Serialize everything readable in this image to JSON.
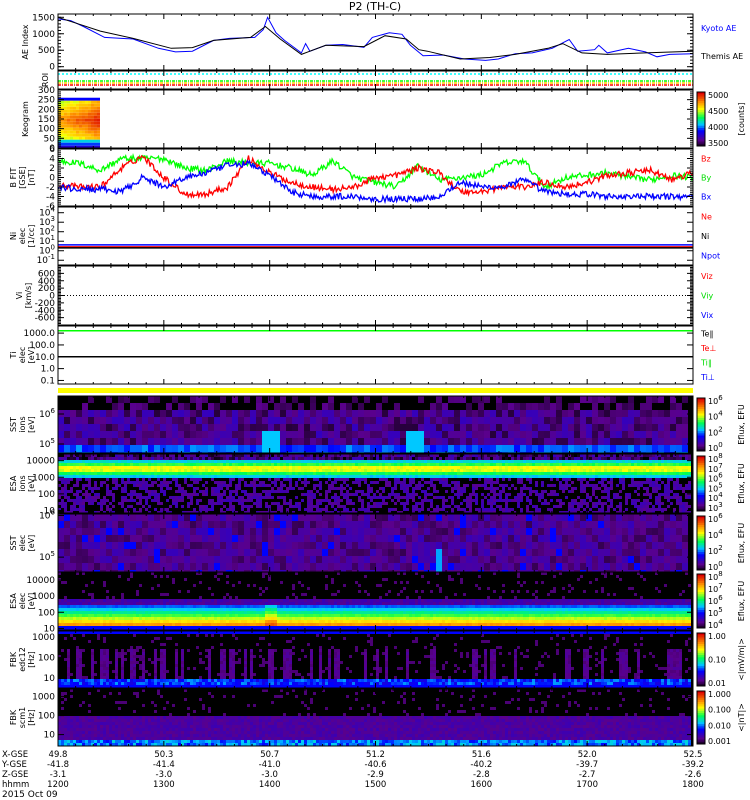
{
  "title": "P2 (TH-C)",
  "date": "2015 Oct 09",
  "ephemeris": {
    "rows": [
      {
        "label": "X-GSE",
        "values": [
          "49.8",
          "50.3",
          "50.7",
          "51.2",
          "51.6",
          "52.0",
          "52.5"
        ]
      },
      {
        "label": "Y-GSE",
        "values": [
          "-41.8",
          "-41.4",
          "-41.0",
          "-40.6",
          "-40.2",
          "-39.7",
          "-39.2"
        ]
      },
      {
        "label": "Z-GSE",
        "values": [
          "-3.1",
          "-3.0",
          "-3.0",
          "-2.9",
          "-2.8",
          "-2.7",
          "-2.6"
        ]
      },
      {
        "label": "hhmm",
        "values": [
          "1200",
          "1300",
          "1400",
          "1500",
          "1600",
          "1700",
          "1800"
        ]
      }
    ]
  },
  "chart_data": [
    {
      "id": "ae",
      "type": "line",
      "ylabel": [
        "AE Index"
      ],
      "ylim": [
        -100,
        1600
      ],
      "log": false,
      "yticks": [
        {
          "v": 1500,
          "l": "1500"
        },
        {
          "v": 1000,
          "l": "1000"
        },
        {
          "v": 500,
          "l": "500"
        },
        {
          "v": 0,
          "l": "0"
        }
      ],
      "legend": [
        {
          "text": "Kyoto AE",
          "color": "#0000ff"
        },
        {
          "text": "Themis AE",
          "color": "#000000"
        }
      ],
      "series": [
        {
          "name": "Kyoto AE",
          "color": "#0000ff",
          "points": [
            [
              12.0,
              1450
            ],
            [
              12.12,
              1400
            ],
            [
              12.24,
              1220
            ],
            [
              12.44,
              890
            ],
            [
              12.71,
              840
            ],
            [
              12.95,
              560
            ],
            [
              13.11,
              450
            ],
            [
              13.27,
              470
            ],
            [
              13.47,
              800
            ],
            [
              13.62,
              860
            ],
            [
              13.86,
              890
            ],
            [
              13.94,
              1125
            ],
            [
              13.98,
              1500
            ],
            [
              14.06,
              1030
            ],
            [
              14.14,
              800
            ],
            [
              14.3,
              420
            ],
            [
              14.34,
              700
            ],
            [
              14.38,
              470
            ],
            [
              14.53,
              650
            ],
            [
              14.69,
              675
            ],
            [
              14.89,
              590
            ],
            [
              14.97,
              890
            ],
            [
              15.13,
              1030
            ],
            [
              15.25,
              985
            ],
            [
              15.33,
              650
            ],
            [
              15.45,
              330
            ],
            [
              15.64,
              356
            ],
            [
              15.84,
              235
            ],
            [
              16.04,
              190
            ],
            [
              16.16,
              235
            ],
            [
              16.32,
              395
            ],
            [
              16.48,
              420
            ],
            [
              16.67,
              560
            ],
            [
              16.83,
              825
            ],
            [
              16.91,
              470
            ],
            [
              17.07,
              515
            ],
            [
              17.11,
              650
            ],
            [
              17.19,
              420
            ],
            [
              17.39,
              560
            ],
            [
              17.55,
              450
            ],
            [
              17.66,
              300
            ],
            [
              17.78,
              375
            ],
            [
              18.0,
              395
            ]
          ]
        },
        {
          "name": "Themis AE",
          "color": "#000000",
          "points": [
            [
              12.0,
              1500
            ],
            [
              12.2,
              1290
            ],
            [
              12.4,
              1080
            ],
            [
              12.71,
              860
            ],
            [
              13.07,
              560
            ],
            [
              13.27,
              580
            ],
            [
              13.47,
              800
            ],
            [
              13.82,
              890
            ],
            [
              13.96,
              1220
            ],
            [
              14.1,
              840
            ],
            [
              14.3,
              375
            ],
            [
              14.38,
              470
            ],
            [
              14.53,
              650
            ],
            [
              14.89,
              610
            ],
            [
              15.09,
              940
            ],
            [
              15.29,
              840
            ],
            [
              15.41,
              515
            ],
            [
              15.49,
              470
            ],
            [
              15.8,
              235
            ],
            [
              16.08,
              280
            ],
            [
              16.32,
              375
            ],
            [
              16.63,
              560
            ],
            [
              16.77,
              700
            ],
            [
              16.95,
              420
            ],
            [
              17.19,
              375
            ],
            [
              17.55,
              420
            ],
            [
              18.0,
              470
            ]
          ]
        }
      ]
    },
    {
      "id": "roi",
      "type": "line",
      "ylabel": [
        "ROI"
      ],
      "yticks": [],
      "legend": [],
      "series": [
        {
          "color": "#00ffff"
        },
        {
          "color": "#00ff00"
        },
        {
          "color": "#ffcc00"
        },
        {
          "color": "#ff0000"
        }
      ]
    },
    {
      "id": "keo",
      "type": "heatmap",
      "ylabel": [
        "Keogram"
      ],
      "ylim": [
        0,
        300
      ],
      "log": false,
      "yticks": [
        {
          "v": 300,
          "l": "300"
        },
        {
          "v": 250,
          "l": "250"
        },
        {
          "v": 200,
          "l": "200"
        },
        {
          "v": 150,
          "l": "150"
        },
        {
          "v": 100,
          "l": "100"
        },
        {
          "v": 50,
          "l": "50"
        },
        {
          "v": 0,
          "l": "0"
        }
      ],
      "coverage": {
        "t_start": 12.0,
        "t_end": 12.4,
        "y_max": 260
      },
      "colorbar": {
        "labels": [
          "5000",
          "4500",
          "4000",
          "3500"
        ],
        "title": "[counts]"
      },
      "legend": []
    },
    {
      "id": "b",
      "type": "line",
      "ylabel": [
        "B FIT",
        "[GSE]",
        "[nT]"
      ],
      "ylim": [
        -6,
        6
      ],
      "log": false,
      "yticks": [
        {
          "v": 6,
          "l": "6"
        },
        {
          "v": 4,
          "l": "4"
        },
        {
          "v": 2,
          "l": "2"
        },
        {
          "v": 0,
          "l": "0"
        },
        {
          "v": -2,
          "l": "-2"
        },
        {
          "v": -4,
          "l": "-4"
        },
        {
          "v": -6,
          "l": "-6"
        }
      ],
      "legend": [
        {
          "text": "Bz",
          "color": "#ff0000"
        },
        {
          "text": "By",
          "color": "#00dd00"
        },
        {
          "text": "Bx",
          "color": "#0000ff"
        }
      ],
      "t0": 12.0,
      "dt": 0.2,
      "series": [
        {
          "name": "By",
          "color": "#00ff00",
          "values": [
            3.5,
            3,
            1.5,
            4,
            4,
            4,
            2,
            1.5,
            3.5,
            3,
            3,
            2,
            0.5,
            3.5,
            0,
            -1,
            -2,
            2.5,
            -0.5,
            0,
            0.5,
            3,
            3.5,
            -2,
            0,
            0.5,
            1,
            0,
            -0.5,
            0.5,
            0
          ]
        },
        {
          "name": "Bz",
          "color": "#ff0000",
          "values": [
            -1.5,
            -2,
            -2,
            2,
            4.5,
            0,
            -3.5,
            -3.5,
            -2,
            4,
            1,
            -1,
            -2,
            -2.5,
            -2,
            0,
            0.5,
            2,
            1,
            -3,
            -3,
            -2,
            -2,
            -1,
            -2,
            -1,
            0.5,
            1,
            1.5,
            -0.5,
            1
          ]
        },
        {
          "name": "Bx",
          "color": "#0000ff",
          "values": [
            -2,
            -2.5,
            -2.5,
            -3,
            0,
            -2,
            0,
            1,
            2.5,
            3,
            0.5,
            -3,
            -4,
            -4,
            -4,
            -4.5,
            -4.5,
            -4.5,
            -4,
            -1,
            -2,
            -2,
            -0.5,
            -3,
            -3.5,
            -3.5,
            -4,
            -4,
            -4,
            -4,
            -4
          ]
        }
      ]
    },
    {
      "id": "ni",
      "type": "line",
      "ylabel": [
        "Ni",
        "elec",
        "[1/cc]"
      ],
      "ylim": [
        -1.5,
        4.6
      ],
      "log": true,
      "yticks": [
        {
          "v": 4,
          "l": "10^4"
        },
        {
          "v": 3,
          "l": "10^3"
        },
        {
          "v": 2,
          "l": "10^2"
        },
        {
          "v": 1,
          "l": "10^1"
        },
        {
          "v": 0,
          "l": "10^0"
        },
        {
          "v": -1,
          "l": "10^-1"
        }
      ],
      "legend": [
        {
          "text": "Ne",
          "color": "#ff0000"
        },
        {
          "text": "Ni",
          "color": "#000000"
        },
        {
          "text": "Npot",
          "color": "#0000ff"
        }
      ],
      "series": [
        {
          "name": "Npot",
          "color": "#0000ff",
          "log_value": 0.62
        },
        {
          "name": "Ne",
          "color": "#ff0000",
          "log_value": 0.4
        },
        {
          "name": "Ni",
          "color": "#000000",
          "log_value": 0.3
        }
      ]
    },
    {
      "id": "vi",
      "type": "line",
      "ylabel": [
        "Vi",
        "[km/s]"
      ],
      "ylim": [
        -800,
        800
      ],
      "log": false,
      "yticks": [
        {
          "v": 600,
          "l": "600"
        },
        {
          "v": 400,
          "l": "400"
        },
        {
          "v": 200,
          "l": "200"
        },
        {
          "v": 0,
          "l": "0"
        },
        {
          "v": -200,
          "l": "-200"
        },
        {
          "v": -400,
          "l": "-400"
        },
        {
          "v": -600,
          "l": "-600"
        }
      ],
      "legend": [
        {
          "text": "Viz",
          "color": "#ff0000"
        },
        {
          "text": "Viy",
          "color": "#00dd00"
        },
        {
          "text": "Vix",
          "color": "#0000ff"
        }
      ],
      "series": []
    },
    {
      "id": "ti",
      "type": "line",
      "ylabel": [
        "Ti",
        "elec",
        "[eV]"
      ],
      "ylim": [
        -1.3,
        3.6
      ],
      "log": true,
      "yticks": [
        {
          "v": 3,
          "l": "1000.0"
        },
        {
          "v": 2,
          "l": "100.0"
        },
        {
          "v": 1,
          "l": "10.0"
        },
        {
          "v": 0,
          "l": "1.0"
        },
        {
          "v": -1,
          "l": "0.1"
        }
      ],
      "legend": [
        {
          "text": "Te∥",
          "color": "#000000"
        },
        {
          "text": "Te⊥",
          "color": "#ff0000"
        },
        {
          "text": "Ti∥",
          "color": "#00dd00"
        },
        {
          "text": "Ti⊥",
          "color": "#0000ff"
        }
      ],
      "series": [
        {
          "name": "Ti∥",
          "color": "#00ff00",
          "log_value": 3.2
        },
        {
          "name": "Te∥",
          "color": "#000000",
          "log_value": 1.0
        }
      ]
    },
    {
      "id": "sst1",
      "type": "heatmap",
      "ylabel": [
        "SST",
        "ions",
        "[eV]"
      ],
      "ylim": [
        4.7,
        6.6
      ],
      "log": true,
      "yticks": [
        {
          "v": 6,
          "l": "10^6"
        },
        {
          "v": 5,
          "l": "10^5"
        }
      ],
      "colorbar": {
        "labels": [
          "10^6",
          "10^4",
          "10^2",
          "10^0"
        ],
        "title": "Eflux, EFU"
      },
      "legend": []
    },
    {
      "id": "esa1",
      "type": "heatmap",
      "ylabel": [
        "ESA",
        "ions",
        "[eV]"
      ],
      "ylim": [
        0.85,
        4.4
      ],
      "log": true,
      "yticks": [
        {
          "v": 4,
          "l": "10000"
        },
        {
          "v": 3,
          "l": "1000"
        },
        {
          "v": 2,
          "l": "100"
        },
        {
          "v": 1,
          "l": "10"
        }
      ],
      "colorbar": {
        "labels": [
          "10^8",
          "10^7",
          "10^6",
          "10^5",
          "10^4",
          "10^3"
        ],
        "title": "Eflux, EFU"
      },
      "legend": []
    },
    {
      "id": "sst2",
      "type": "heatmap",
      "ylabel": [
        "SST",
        "elec",
        "[eV]"
      ],
      "ylim": [
        4.5,
        6.45
      ],
      "log": true,
      "yticks": [
        {
          "v": 6.4,
          "l": "10^6"
        },
        {
          "v": 5,
          "l": "10^5"
        }
      ],
      "colorbar": {
        "labels": [
          "10^6",
          "10^4",
          "10^2",
          "10^0"
        ],
        "title": "Eflux, EFU"
      },
      "legend": []
    },
    {
      "id": "esa2",
      "type": "heatmap",
      "ylabel": [
        "ESA",
        "elec",
        "[eV]"
      ],
      "ylim": [
        0.9,
        4.5
      ],
      "log": true,
      "yticks": [
        {
          "v": 4,
          "l": "10000"
        },
        {
          "v": 3,
          "l": "1000"
        },
        {
          "v": 2,
          "l": "100"
        },
        {
          "v": 1,
          "l": "10"
        }
      ],
      "colorbar": {
        "labels": [
          "10^8",
          "10^7",
          "10^6",
          "10^5",
          "10^4"
        ],
        "title": "Eflux, EFU"
      },
      "legend": []
    },
    {
      "id": "fbk1",
      "type": "heatmap",
      "ylabel": [
        "FBK",
        "edc12",
        "[Hz]"
      ],
      "ylim": [
        0.5,
        3.3
      ],
      "log": true,
      "yticks": [
        {
          "v": 3,
          "l": "1000"
        },
        {
          "v": 2,
          "l": "100"
        },
        {
          "v": 1,
          "l": "10"
        }
      ],
      "colorbar": {
        "labels": [
          "1.00",
          "0.10",
          "0.01"
        ],
        "title": "<|mV/m|>"
      },
      "legend": []
    },
    {
      "id": "fbk2",
      "type": "heatmap",
      "ylabel": [
        "FBK",
        "scm1",
        "[Hz]"
      ],
      "ylim": [
        0.4,
        3.4
      ],
      "log": true,
      "yticks": [
        {
          "v": 3,
          "l": "1000"
        },
        {
          "v": 2,
          "l": "100"
        },
        {
          "v": 1,
          "l": "10"
        }
      ],
      "colorbar": {
        "labels": [
          "1.000",
          "0.100",
          "0.010",
          "0.001"
        ],
        "title": "<|nT|>"
      },
      "legend": []
    }
  ]
}
